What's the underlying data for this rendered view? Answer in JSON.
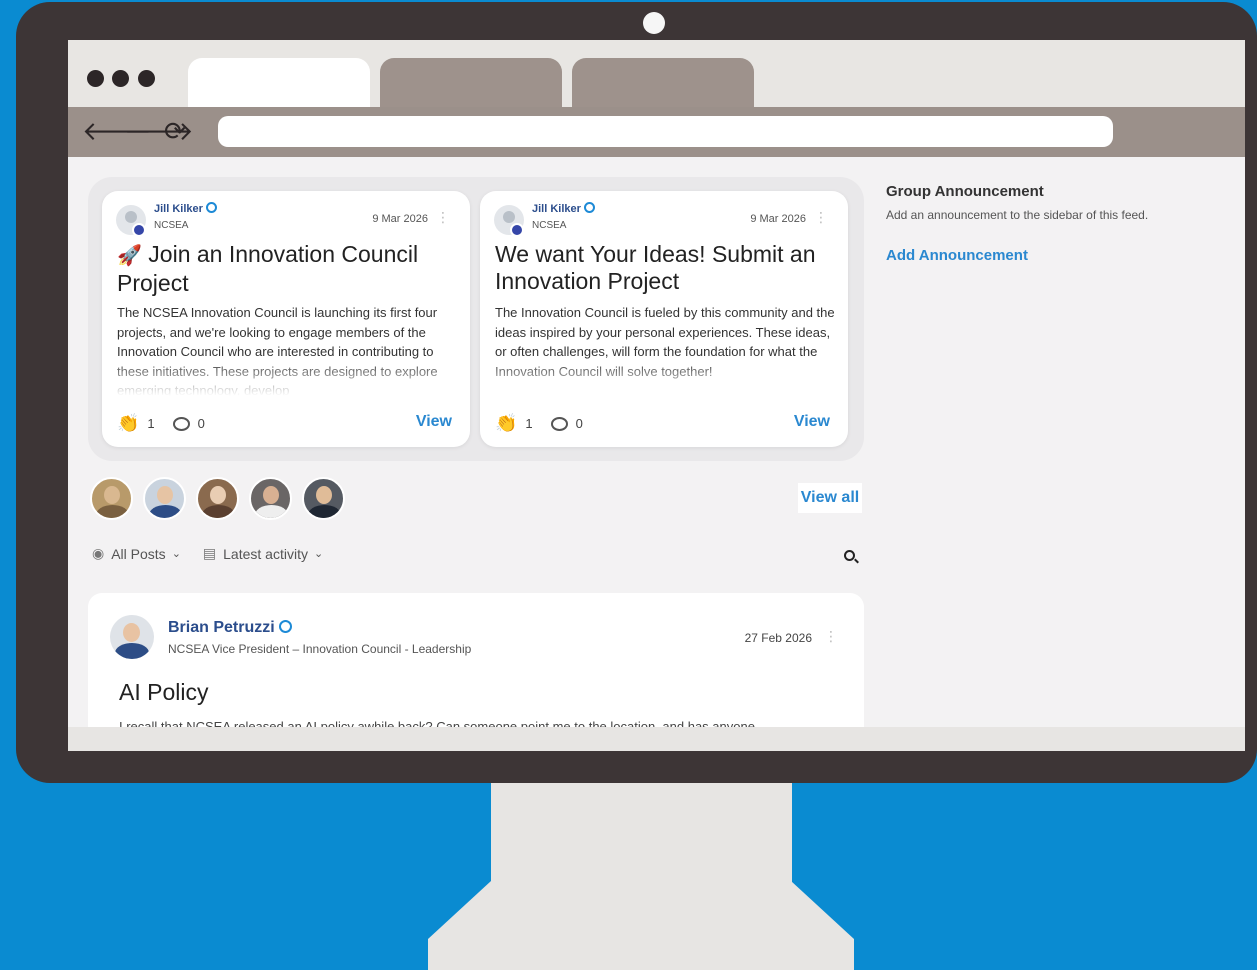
{
  "featured_cards": [
    {
      "author": "Jill Kilker",
      "org": "NCSEA",
      "date": "9 Mar 2026",
      "icon": "rocket-icon",
      "title": "Join an Innovation Council Project",
      "excerpt": "The NCSEA Innovation Council is launching its first four projects, and we're looking to engage members of the Innovation Council who are interested in contributing to these initiatives. These projects are designed to explore emerging technology, develop",
      "reactions": "1",
      "comments": "0",
      "view_label": "View"
    },
    {
      "author": "Jill Kilker",
      "org": "NCSEA",
      "date": "9 Mar 2026",
      "title": "We want Your Ideas! Submit an Innovation Project",
      "excerpt": "The Innovation Council is fueled by this community and the ideas inspired by your personal experiences.  These ideas, or often challenges, will form the foundation for what the Innovation Council will solve together!",
      "reactions": "1",
      "comments": "0",
      "view_label": "View"
    }
  ],
  "members": {
    "view_all_label": "View all"
  },
  "filters": {
    "posts_label": "All Posts",
    "sort_label": "Latest activity"
  },
  "post": {
    "author": "Brian Petruzzi",
    "role": "NCSEA Vice President – Innovation Council - Leadership",
    "date": "27 Feb 2026",
    "title": "AI Policy",
    "body": "I recall that NCSEA released an AI policy awhile back?  Can someone point me to the location, and has anyone"
  },
  "sidebar": {
    "heading": "Group Announcement",
    "description": "Add an announcement to the sidebar of this feed.",
    "add_label": "Add Announcement"
  },
  "colors": {
    "background": "#0a8bd1",
    "monitor": "#3d3536",
    "link": "#2a88d0",
    "author": "#2b4d8c"
  }
}
